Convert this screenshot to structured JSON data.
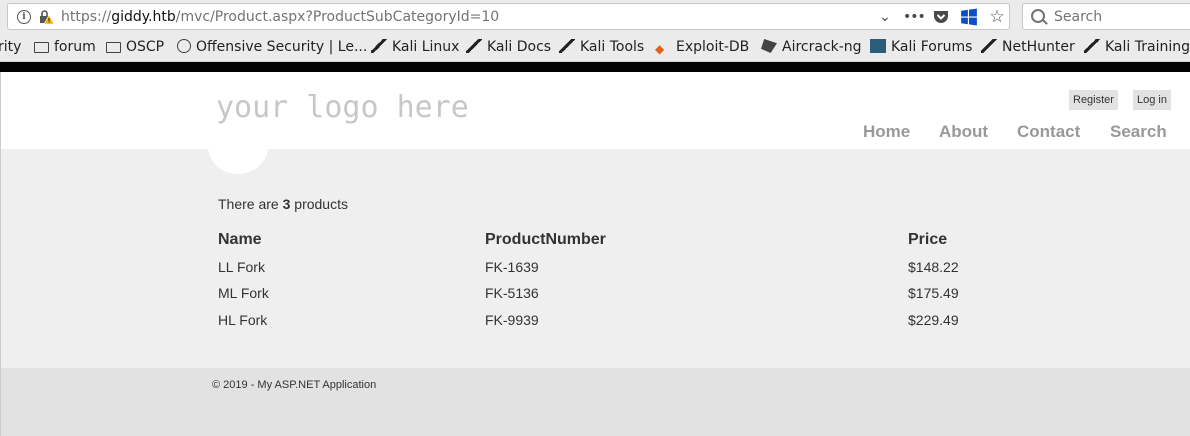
{
  "browser": {
    "url_prefix": "https://",
    "url_host": "giddy.htb",
    "url_path": "/mvc/Product.aspx?ProductSubCategoryId=10",
    "search_placeholder": "Search",
    "bookmarks": [
      {
        "label": "rity",
        "icon": "none"
      },
      {
        "label": "forum",
        "icon": "folder-icon"
      },
      {
        "label": "OSCP",
        "icon": "folder-icon"
      },
      {
        "label": "Offensive Security | Le...",
        "icon": "globe-icon"
      },
      {
        "label": "Kali Linux",
        "icon": "kali-dragon-icon"
      },
      {
        "label": "Kali Docs",
        "icon": "kali-dragon-icon"
      },
      {
        "label": "Kali Tools",
        "icon": "kali-dragon-icon"
      },
      {
        "label": "Exploit-DB",
        "icon": "exploit-db-icon"
      },
      {
        "label": "Aircrack-ng",
        "icon": "aircrack-icon"
      },
      {
        "label": "Kali Forums",
        "icon": "kali-forums-icon"
      },
      {
        "label": "NetHunter",
        "icon": "kali-dragon-icon"
      },
      {
        "label": "Kali Training",
        "icon": "kali-dragon-icon"
      }
    ]
  },
  "site": {
    "logo_text": "your logo here",
    "register_label": "Register",
    "login_label": "Log in",
    "nav": [
      "Home",
      "About",
      "Contact",
      "Search"
    ]
  },
  "main": {
    "count_prefix": "There are ",
    "count_value": "3",
    "count_suffix": " products",
    "columns": [
      "Name",
      "ProductNumber",
      "Price"
    ],
    "rows": [
      [
        "LL Fork",
        "FK-1639",
        "$148.22"
      ],
      [
        "ML Fork",
        "FK-5136",
        "$175.49"
      ],
      [
        "HL Fork",
        "FK-9939",
        "$229.49"
      ]
    ]
  },
  "footer": {
    "copyright": "© 2019 - My ASP.NET Application"
  }
}
